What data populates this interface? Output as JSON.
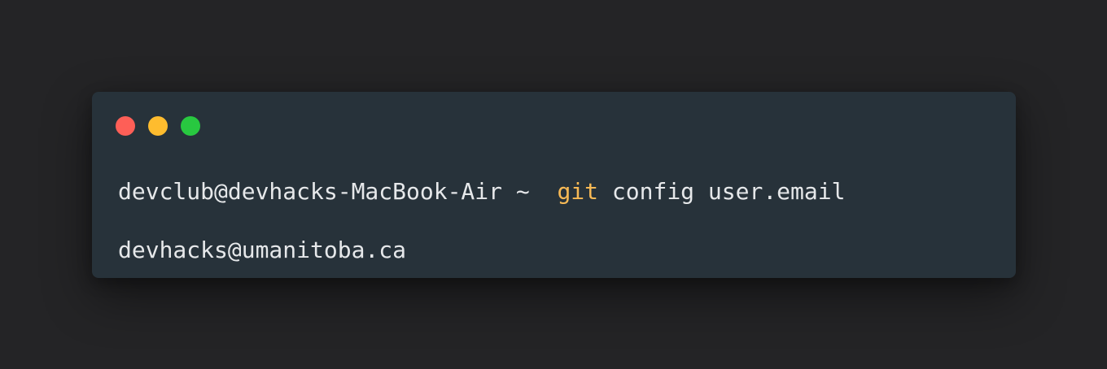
{
  "colors": {
    "background": "#242426",
    "terminal_background": "#27323a",
    "text": "#e6e8ea",
    "keyword": "#f7b955",
    "dot_red": "#fe5f57",
    "dot_yellow": "#febc2e",
    "dot_green": "#28c840"
  },
  "terminal": {
    "window_controls": [
      {
        "name": "close",
        "icon": "red-dot-icon"
      },
      {
        "name": "minimize",
        "icon": "yellow-dot-icon"
      },
      {
        "name": "zoom",
        "icon": "green-dot-icon"
      }
    ],
    "command": {
      "prompt": "devclub@devhacks-MacBook-Air ~",
      "keyword": "git",
      "arguments": "config user.email"
    },
    "output": "devhacks@umanitoba.ca"
  }
}
